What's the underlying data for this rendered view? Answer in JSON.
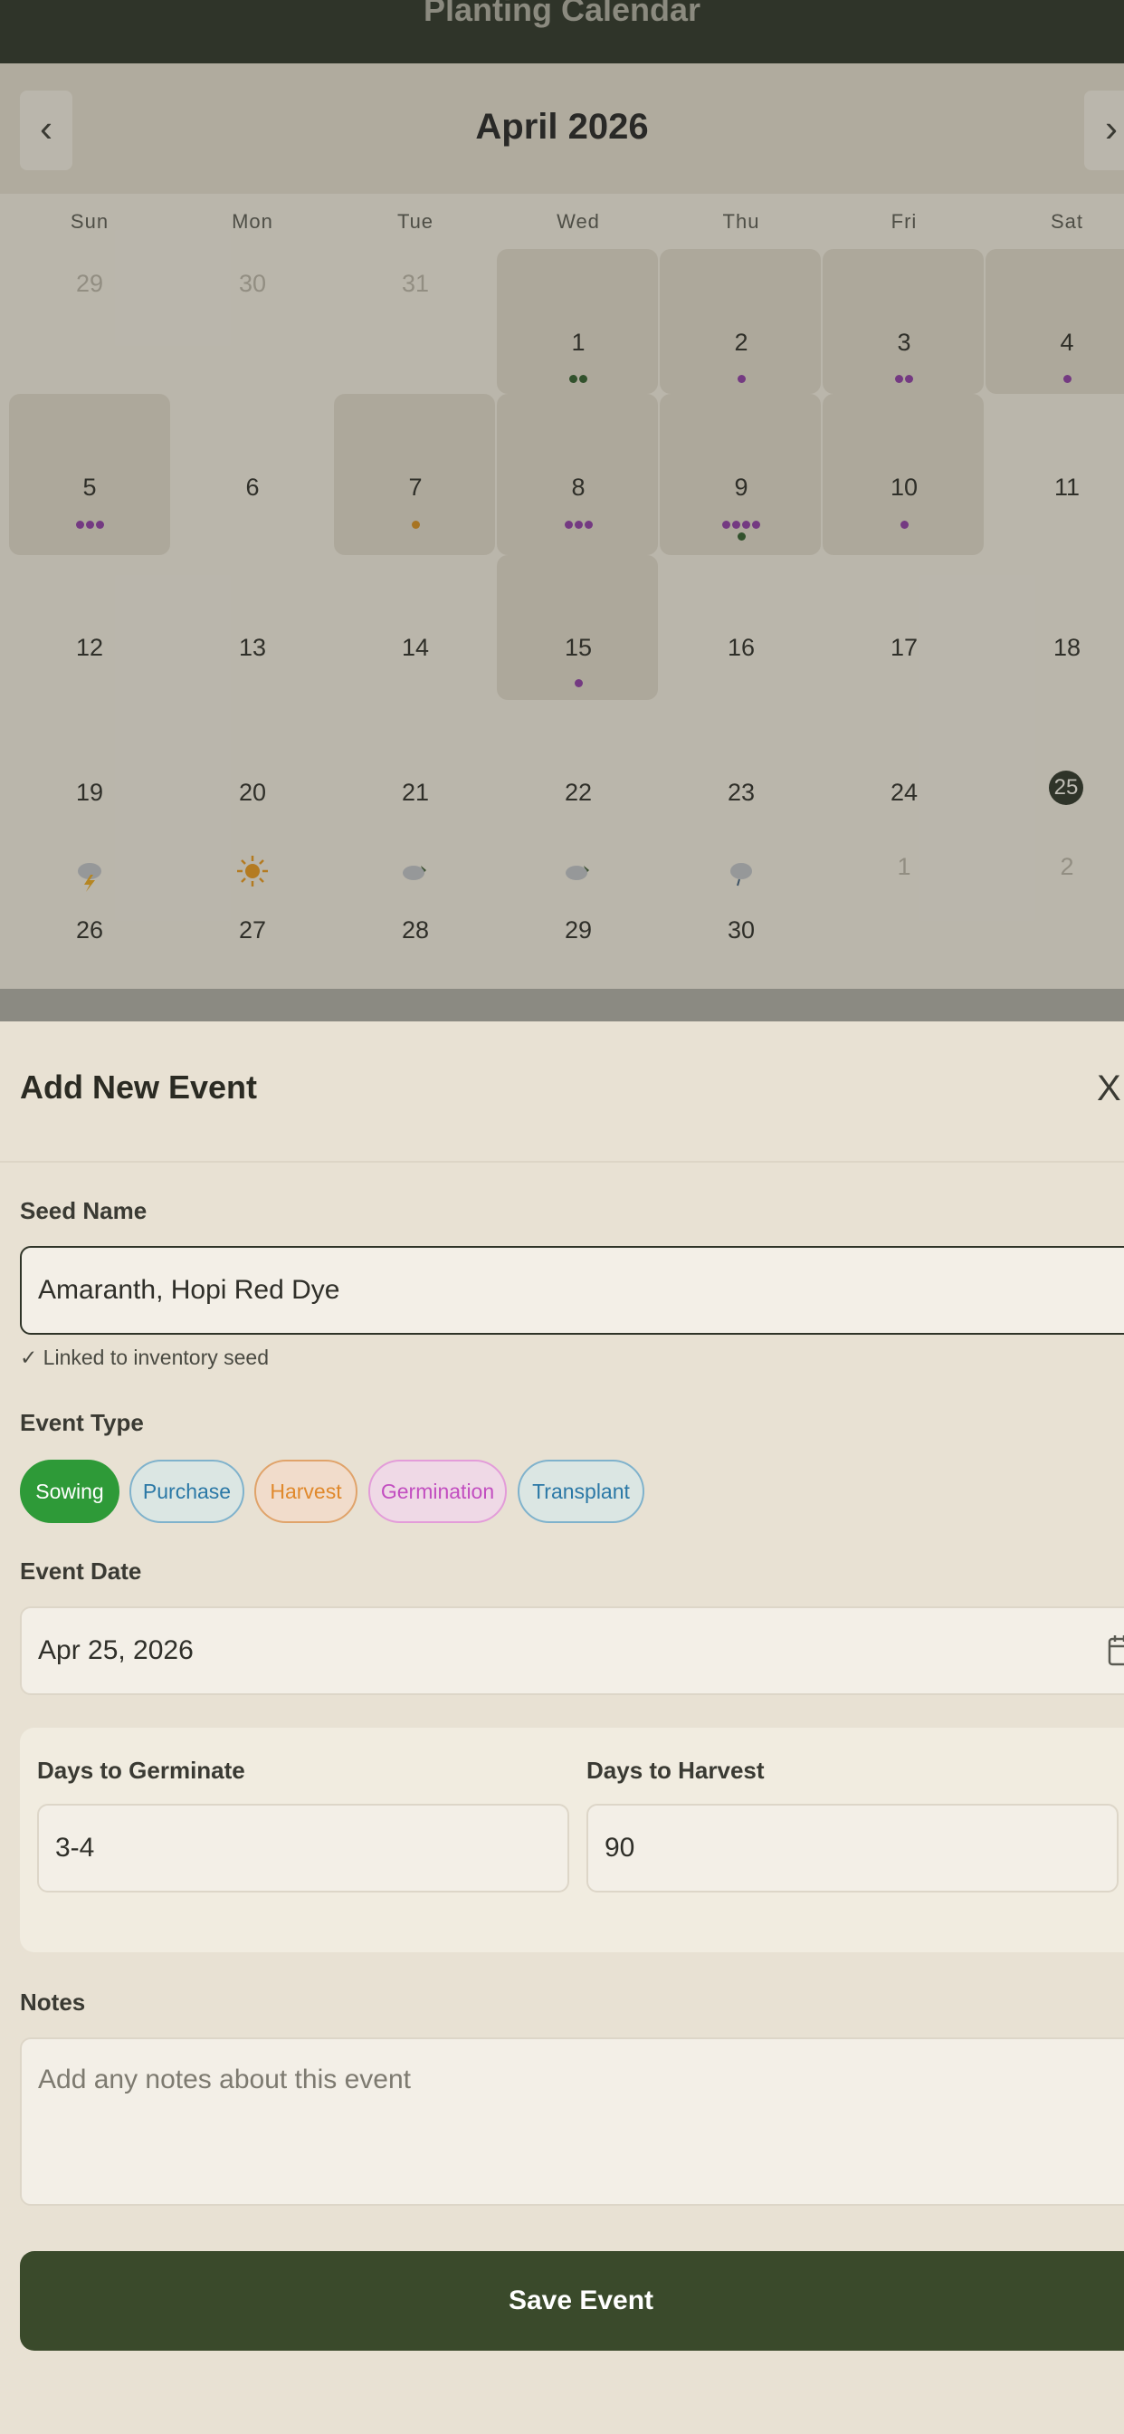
{
  "header": {
    "title": "Planting Calendar"
  },
  "calendar": {
    "month_label": "April 2026",
    "prev_icon": "chevron-left-icon",
    "next_icon": "chevron-right-icon",
    "weekdays": [
      "Sun",
      "Mon",
      "Tue",
      "Wed",
      "Thu",
      "Fri",
      "Sat"
    ],
    "days": {
      "d29p": "29",
      "d30p": "30",
      "d31p": "31",
      "d1": "1",
      "d2": "2",
      "d3": "3",
      "d4": "4",
      "d5": "5",
      "d6": "6",
      "d7": "7",
      "d8": "8",
      "d9": "9",
      "d10": "10",
      "d11": "11",
      "d12": "12",
      "d13": "13",
      "d14": "14",
      "d15": "15",
      "d16": "16",
      "d17": "17",
      "d18": "18",
      "d19": "19",
      "d20": "20",
      "d21": "21",
      "d22": "22",
      "d23": "23",
      "d24": "24",
      "d25": "25",
      "d26": "26",
      "d27": "27",
      "d28": "28",
      "d29": "29",
      "d30": "30",
      "n1": "1",
      "n2": "2"
    },
    "today": "25",
    "event_colors": {
      "purple": "#8a3aa0",
      "green": "#2f5a2a",
      "orange": "#d08a1c"
    },
    "weather_icons": [
      "thunderstorm-icon",
      "sun-icon",
      "cloud-partly-icon",
      "cloud-partly-icon",
      "cloud-rain-icon"
    ]
  },
  "sheet": {
    "title": "Add New Event",
    "close_label": "X",
    "seed_name_label": "Seed Name",
    "seed_name_value": "Amaranth, Hopi Red Dye",
    "linked_hint": "✓ Linked to inventory seed",
    "event_type_label": "Event Type",
    "event_types": [
      "Sowing",
      "Purchase",
      "Harvest",
      "Germination",
      "Transplant"
    ],
    "selected_event_type": "Sowing",
    "event_date_label": "Event Date",
    "event_date_value": "Apr 25, 2026",
    "days_to_germinate_label": "Days to Germinate",
    "days_to_germinate_value": "3-4",
    "days_to_harvest_label": "Days to Harvest",
    "days_to_harvest_value": "90",
    "notes_label": "Notes",
    "notes_placeholder": "Add any notes about this event",
    "save_label": "Save Event",
    "accent_color": "#3a4a2b",
    "sowing_color": "#2e9a38"
  }
}
